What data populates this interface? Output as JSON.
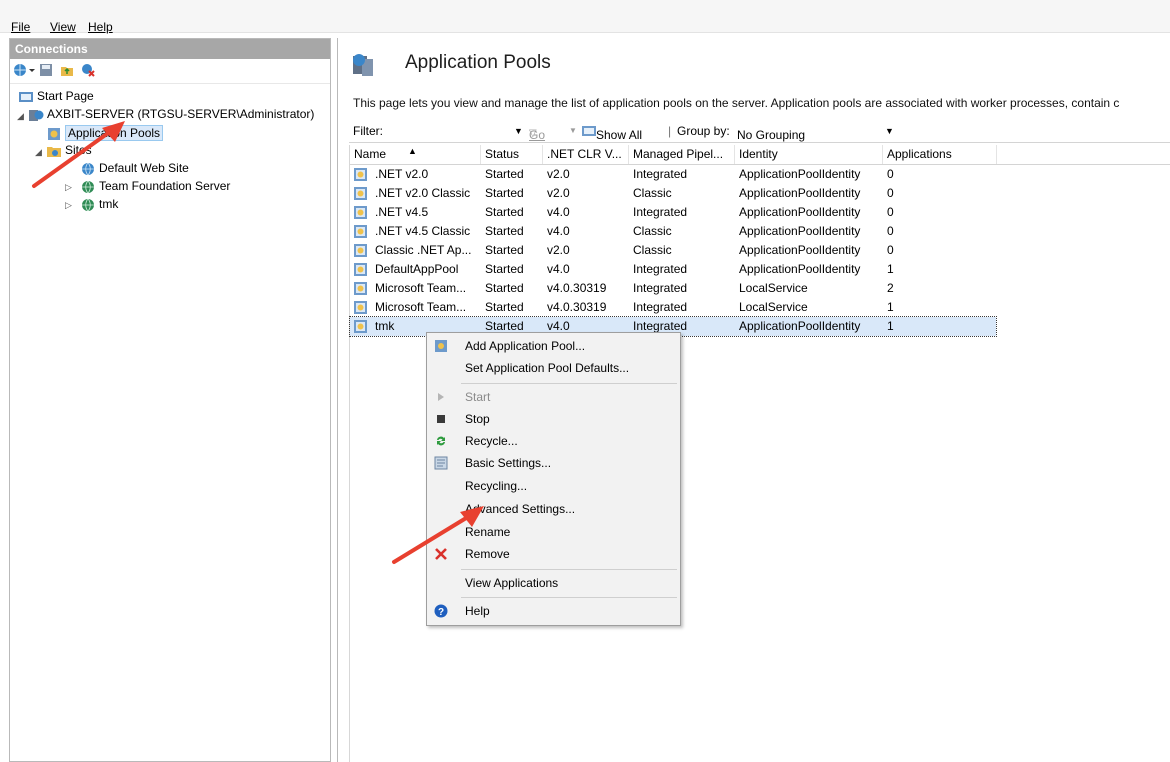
{
  "menubar": {
    "file": "File",
    "view": "View",
    "help": "Help"
  },
  "connections": {
    "title": "Connections",
    "tree": {
      "start_page": "Start Page",
      "server": "AXBIT-SERVER (RTGSU-SERVER\\Administrator)",
      "app_pools": "Application Pools",
      "sites": "Sites",
      "site1": "Default Web Site",
      "site2": "Team Foundation Server",
      "site3": "tmk"
    }
  },
  "main": {
    "title": "Application Pools",
    "description": "This page lets you view and manage the list of application pools on the server. Application pools are associated with worker processes, contain c",
    "filter": {
      "label": "Filter:",
      "go": "Go",
      "show_all": "Show All",
      "group_by_label": "Group by:",
      "group_by_value": "No Grouping"
    },
    "columns": [
      "Name",
      "Status",
      ".NET CLR V...",
      "Managed Pipel...",
      "Identity",
      "Applications"
    ],
    "rows": [
      {
        "name": ".NET v2.0",
        "status": "Started",
        "clr": "v2.0",
        "pipeline": "Integrated",
        "identity": "ApplicationPoolIdentity",
        "apps": "0"
      },
      {
        "name": ".NET v2.0 Classic",
        "status": "Started",
        "clr": "v2.0",
        "pipeline": "Classic",
        "identity": "ApplicationPoolIdentity",
        "apps": "0"
      },
      {
        "name": ".NET v4.5",
        "status": "Started",
        "clr": "v4.0",
        "pipeline": "Integrated",
        "identity": "ApplicationPoolIdentity",
        "apps": "0"
      },
      {
        "name": ".NET v4.5 Classic",
        "status": "Started",
        "clr": "v4.0",
        "pipeline": "Classic",
        "identity": "ApplicationPoolIdentity",
        "apps": "0"
      },
      {
        "name": "Classic .NET Ap...",
        "status": "Started",
        "clr": "v2.0",
        "pipeline": "Classic",
        "identity": "ApplicationPoolIdentity",
        "apps": "0"
      },
      {
        "name": "DefaultAppPool",
        "status": "Started",
        "clr": "v4.0",
        "pipeline": "Integrated",
        "identity": "ApplicationPoolIdentity",
        "apps": "1"
      },
      {
        "name": "Microsoft Team...",
        "status": "Started",
        "clr": "v4.0.30319",
        "pipeline": "Integrated",
        "identity": "LocalService",
        "apps": "2"
      },
      {
        "name": "Microsoft Team...",
        "status": "Started",
        "clr": "v4.0.30319",
        "pipeline": "Integrated",
        "identity": "LocalService",
        "apps": "1"
      },
      {
        "name": "tmk",
        "status": "Started",
        "clr": "v4.0",
        "pipeline": "Integrated",
        "identity": "ApplicationPoolIdentity",
        "apps": "1"
      }
    ]
  },
  "context_menu": {
    "add_pool": "Add Application Pool...",
    "set_defaults": "Set Application Pool Defaults...",
    "start": "Start",
    "stop": "Stop",
    "recycle": "Recycle...",
    "basic_settings": "Basic Settings...",
    "recycling": "Recycling...",
    "advanced_settings": "Advanced Settings...",
    "rename": "Rename",
    "remove": "Remove",
    "view_applications": "View Applications",
    "help": "Help"
  },
  "colors": {
    "annotation_arrow": "#e8402f",
    "selection": "#d9e8f9",
    "pane_header": "#a7a7a7",
    "remove_icon": "#d9312b",
    "help_icon": "#1f5fbf"
  }
}
